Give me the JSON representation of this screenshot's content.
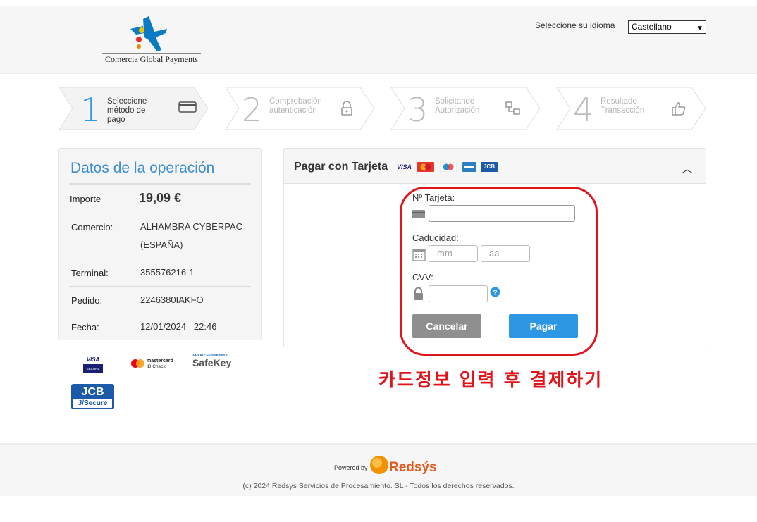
{
  "header": {
    "logo_text": "Comercia Global Payments",
    "language_label": "Seleccione su idioma",
    "language_selected": "Castellano"
  },
  "steps": [
    {
      "number": "1",
      "line1": "Seleccione",
      "line2": "método de pago",
      "icon": "credit-card-icon",
      "active": true
    },
    {
      "number": "2",
      "line1": "Comprobación",
      "line2": "autenticación",
      "icon": "lock-icon",
      "active": false
    },
    {
      "number": "3",
      "line1": "Solicitando",
      "line2": "Autorización",
      "icon": "network-icon",
      "active": false
    },
    {
      "number": "4",
      "line1": "Resultado",
      "line2": "Transacción",
      "icon": "thumbs-up-icon",
      "active": false
    }
  ],
  "operation": {
    "title": "Datos de la operación",
    "amount_label": "Importe",
    "amount_value": "19,09 €",
    "merchant_label": "Comercio:",
    "merchant_value": "ALHAMBRA CYBERPAC (ESPAÑA)",
    "terminal_label": "Terminal:",
    "terminal_value": "355576216-1",
    "order_label": "Pedido:",
    "order_value": "2246380IAKFO",
    "date_label": "Fecha:",
    "date_value": "12/01/2024   22:46"
  },
  "security_brands": {
    "visa_top": "VISA",
    "visa_bottom": "SECURE",
    "mastercard_top": "mastercard",
    "mastercard_bottom": "ID Check",
    "amex_top": "AMERICAN EXPRESS",
    "amex_bottom": "SafeKey",
    "jcb_top": "JCB",
    "jcb_bottom": "J/Secure"
  },
  "payment": {
    "title": "Pagar con Tarjeta",
    "card_number_label": "Nº Tarjeta:",
    "expiry_label": "Caducidad:",
    "month_placeholder": "mm",
    "year_placeholder": "aa",
    "cvv_label": "CVV:",
    "cancel_label": "Cancelar",
    "pay_label": "Pagar",
    "card_logos": {
      "visa": "VISA",
      "jcb": "JCB"
    }
  },
  "annotation": "카드정보 입력 후 결제하기",
  "footer": {
    "powered_by": "Powered by",
    "brand": "Redsýs",
    "copyright": "(c) 2024 Redsys Servicios de Procesamiento. SL - Todos los derechos reservados."
  },
  "colors": {
    "accent_blue": "#3d8fd1",
    "pay_button": "#2e97e4",
    "cancel_button": "#8f8f8f",
    "annotation_red": "#e0151b",
    "redsys_orange": "#e35b1d"
  }
}
